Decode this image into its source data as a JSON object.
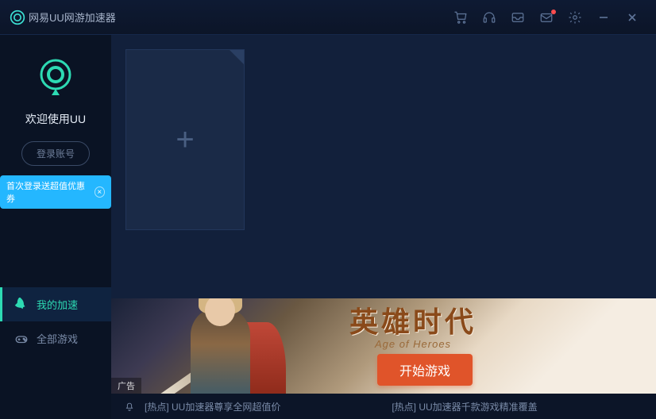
{
  "titlebar": {
    "title": "网易UU网游加速器"
  },
  "sidebar": {
    "welcome": "欢迎使用UU",
    "login_label": "登录账号",
    "promo_text": "首次登录送超值优惠券",
    "nav": [
      {
        "label": "我的加速",
        "active": true
      },
      {
        "label": "全部游戏",
        "active": false
      }
    ]
  },
  "banner": {
    "title": "英雄时代",
    "subtitle": "Age of Heroes",
    "cta": "开始游戏",
    "ad_label": "广告"
  },
  "ticker": {
    "items": [
      "[热点] UU加速器尊享全网超值价",
      "[热点] UU加速器千款游戏精准覆盖"
    ]
  }
}
